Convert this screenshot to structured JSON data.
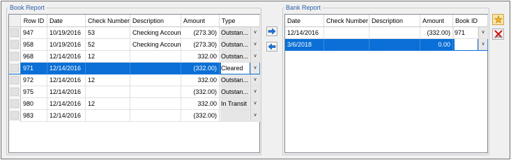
{
  "book_report": {
    "title": "Book Report",
    "columns": [
      "Row ID",
      "Date",
      "Check Number",
      "Description",
      "Amount",
      "Type"
    ],
    "rows": [
      {
        "row_id": "947",
        "date": "10/19/2016",
        "check": "53",
        "desc": "Checking Account",
        "amount": "(273.30)",
        "type": "Outstan..."
      },
      {
        "row_id": "958",
        "date": "10/19/2016",
        "check": "52",
        "desc": "Checking Account",
        "amount": "(273.30)",
        "type": "Outstan..."
      },
      {
        "row_id": "968",
        "date": "12/14/2016",
        "check": "12",
        "desc": "",
        "amount": "332.00",
        "type": "Outstan..."
      },
      {
        "row_id": "971",
        "date": "12/14/2016",
        "check": "",
        "desc": "",
        "amount": "(332.00)",
        "type": "Cleared"
      },
      {
        "row_id": "972",
        "date": "12/14/2016",
        "check": "12",
        "desc": "",
        "amount": "332.00",
        "type": "Outstan..."
      },
      {
        "row_id": "975",
        "date": "12/14/2016",
        "check": "",
        "desc": "",
        "amount": "(332.00)",
        "type": "Outstan..."
      },
      {
        "row_id": "980",
        "date": "12/14/2016",
        "check": "12",
        "desc": "",
        "amount": "332.00",
        "type": "In Transit"
      },
      {
        "row_id": "983",
        "date": "12/14/2016",
        "check": "",
        "desc": "",
        "amount": "(332.00)",
        "type": ""
      }
    ]
  },
  "bank_report": {
    "title": "Bank Report",
    "columns": [
      "Date",
      "Check Number",
      "Description",
      "Amount",
      "Book ID"
    ],
    "rows": [
      {
        "date": "12/14/2016",
        "check": "",
        "desc": "",
        "amount": "(332.00)",
        "book_id": "971"
      },
      {
        "date": "3/6/2018",
        "check": "",
        "desc": "",
        "amount": "0.00",
        "book_id": ""
      }
    ]
  },
  "icons": {
    "move_right": "arrow-right-icon",
    "move_left": "arrow-left-icon",
    "add": "add-star-icon",
    "delete": "delete-x-icon"
  },
  "colors": {
    "selection": "#0a6fd6",
    "legend_text": "#2a5fa8",
    "arrow_blue": "#1e73d8",
    "delete_red": "#d01010"
  }
}
